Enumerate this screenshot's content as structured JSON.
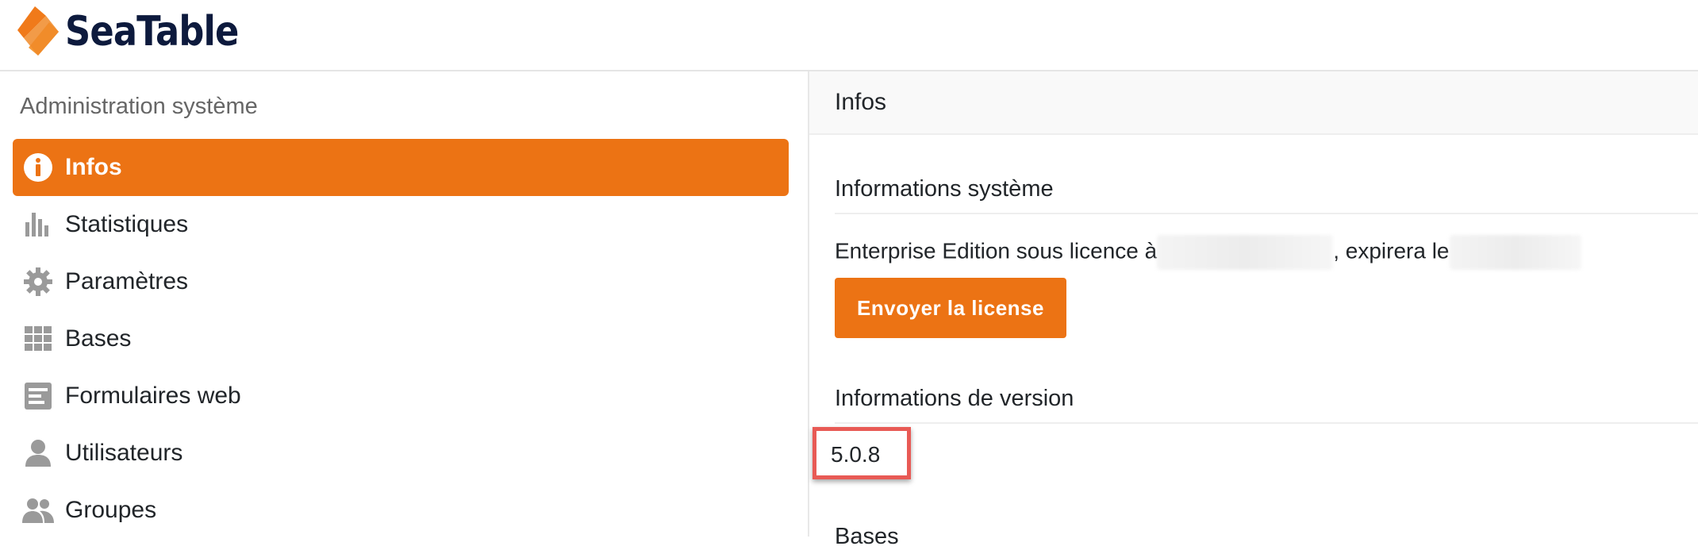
{
  "app": {
    "brand": "SeaTable"
  },
  "colors": {
    "accent": "#ec7314",
    "highlight": "#e85a55",
    "brand_dark": "#0d1a3d"
  },
  "sidebar": {
    "title": "Administration système",
    "items": [
      {
        "label": "Infos",
        "icon": "info-icon",
        "active": true
      },
      {
        "label": "Statistiques",
        "icon": "bar-chart-icon"
      },
      {
        "label": "Paramètres",
        "icon": "gear-icon"
      },
      {
        "label": "Bases",
        "icon": "grid-icon"
      },
      {
        "label": "Formulaires web",
        "icon": "form-icon"
      },
      {
        "label": "Utilisateurs",
        "icon": "user-icon"
      },
      {
        "label": "Groupes",
        "icon": "group-icon"
      }
    ]
  },
  "main": {
    "title": "Infos",
    "system_section": {
      "title": "Informations système",
      "license_prefix": "Enterprise Edition sous licence à",
      "license_middle": ", expirera le",
      "button_label": "Envoyer la license"
    },
    "version_section": {
      "title": "Informations de version",
      "version": "5.0.8"
    },
    "bases_section": {
      "title": "Bases"
    }
  }
}
